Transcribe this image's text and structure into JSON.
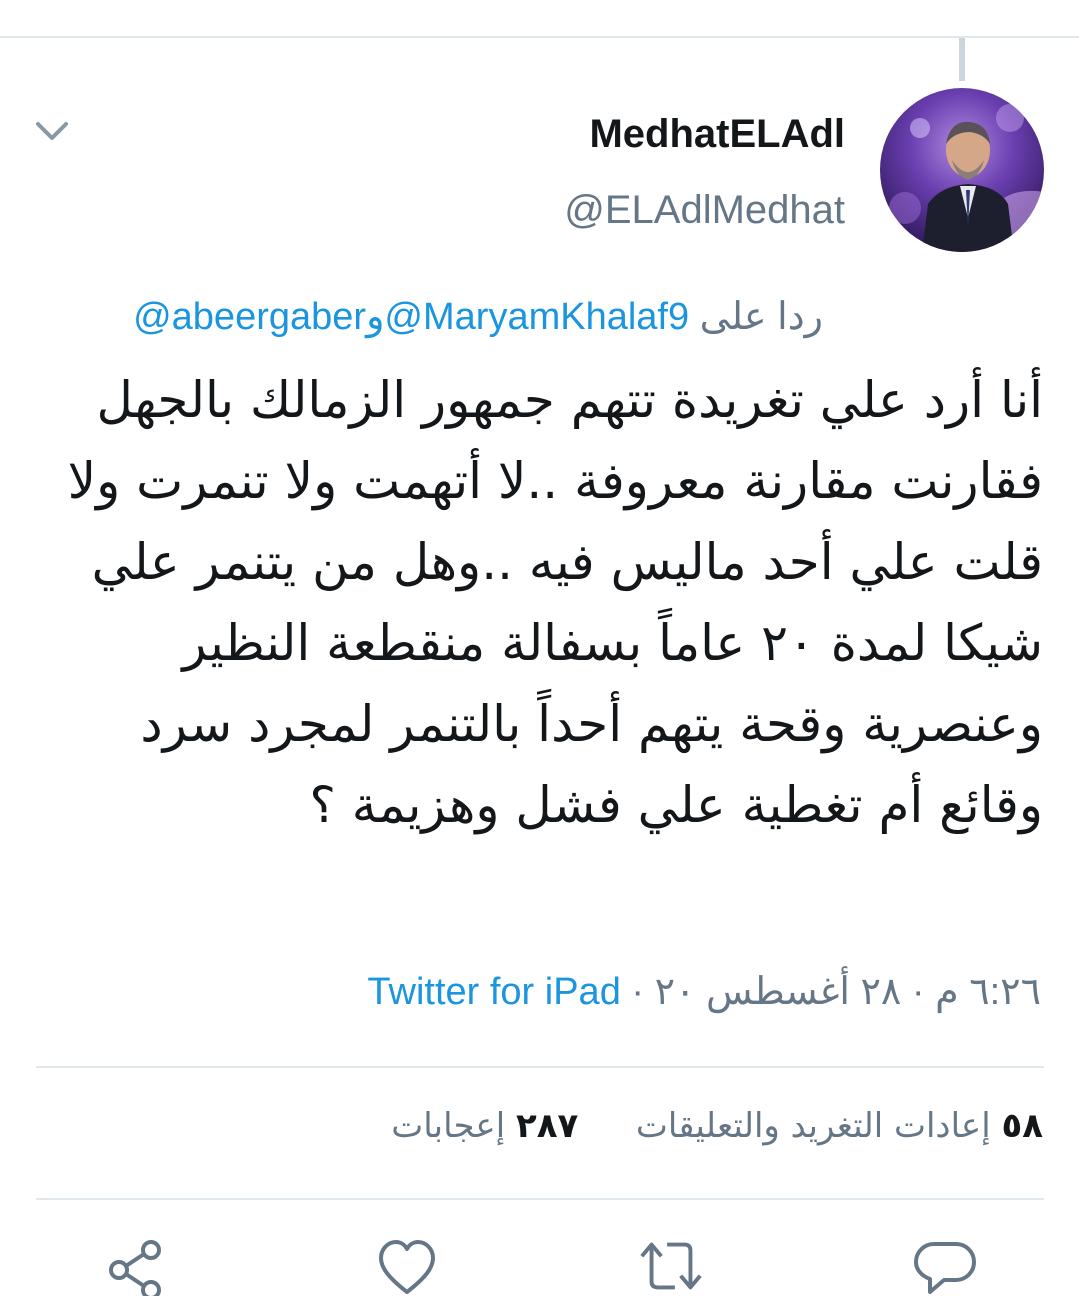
{
  "tweet": {
    "display_name": "MedhatELAdl",
    "handle": "@ELAdlMedhat",
    "reply_to": {
      "prefix": "ردا على",
      "user1": "@MaryamKhalaf9",
      "conjunction": "و",
      "user2": "@abeergaber"
    },
    "text": "أنا أرد علي تغريدة تتهم جمهور الزمالك بالجهل فقارنت مقارنة معروفة ..لا أتهمت ولا تنمرت ولا قلت علي أحد ماليس فيه ..وهل من يتنمر علي شيكا لمدة ٢٠ عاماً بسفالة منقطعة النظير وعنصرية وقحة يتهم أحداً بالتنمر لمجرد سرد وقائع أم تغطية علي فشل وهزيمة ؟",
    "time": "٦:٢٦ م",
    "date": "٢٨ أغسطس ٢٠",
    "source": "Twitter for iPad",
    "separator": "·"
  },
  "stats": {
    "retweets_count": "٥٨",
    "retweets_label": "إعادات التغريد والتعليقات",
    "likes_count": "٢٨٧",
    "likes_label": "إعجابات"
  },
  "icons": {
    "menu": "chevron-down-icon",
    "reply": "comment-icon",
    "retweet": "retweet-icon",
    "like": "heart-icon",
    "share": "share-icon"
  },
  "colors": {
    "link": "#1b95e0",
    "secondary_text": "#657786",
    "icon": "#657786",
    "divider": "#e1e8ed"
  }
}
